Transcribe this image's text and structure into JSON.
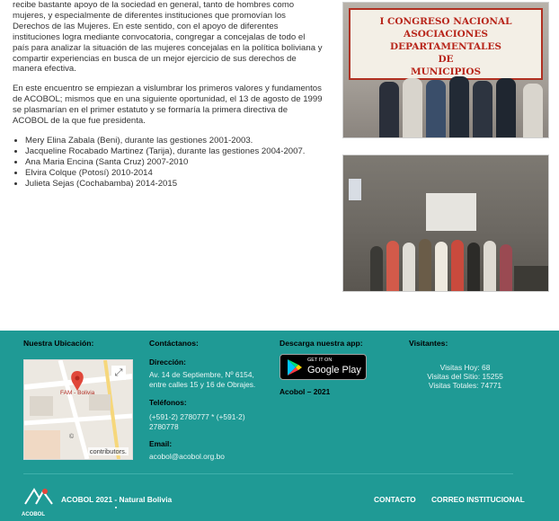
{
  "article": {
    "p1": "recibe bastante apoyo de la sociedad en general, tanto de hombres como mujeres, y especialmente de diferentes instituciones que promovían los Derechos de las Mujeres. En este sentido, con el apoyo de diferentes instituciones logra mediante convocatoria, congregar a concejalas de todo el país para analizar la situación de las mujeres concejalas en la política boliviana y compartir experiencias en busca de un mejor ejercicio de sus derechos de manera efectiva.",
    "p2": "En este encuentro se empiezan a vislumbrar los primeros valores y fundamentos de ACOBOL; mismos que en una siguiente oportunidad, el 13 de agosto de 1999 se plasmarían en el primer estatuto y se formaría la primera directiva de ACOBOL de la que fue presidenta.",
    "presidents": [
      "Mery Elina Zabala (Beni), durante las gestiones 2001-2003.",
      "Jacqueline Rocabado Martinez (Tarija), durante las gestiones 2004-2007.",
      "Ana Maria Encina (Santa Cruz) 2007-2010",
      "Elvira Colque (Potosí) 2010-2014",
      "Julieta Sejas (Cochabamba) 2014-2015"
    ]
  },
  "photo1": {
    "banner_lines": [
      "I CONGRESO NACIONAL",
      "ASOCIACIONES DEPARTAMENTALES",
      "DE",
      "MUNICIPIOS"
    ]
  },
  "footer": {
    "location_title": "Nuestra Ubicación:",
    "map_label": "FAM - Bolivia",
    "map_attribution": "contributors.",
    "map_copyright": "©",
    "contact_title": "Contáctanos:",
    "address_label": "Dirección:",
    "address": "Av. 14 de Septiembre, Nº 6154, entre calles 15 y 16 de Obrajes.",
    "phones_label": "Teléfonos:",
    "phones": "(+591-2) 2780777 * (+591-2) 2780778",
    "email_label": "Email:",
    "email": "acobol@acobol.org.bo",
    "download_title": "Descarga nuestra app:",
    "gplay_small": "GET IT ON",
    "gplay_big": "Google Play",
    "app_name": "Acobol – 2021",
    "visitors_title": "Visitantes:",
    "visits_today": "Visitas Hoy: 68",
    "visits_site": "Visitas del Sitio: 15255",
    "visits_total": "Visitas Totales: 74771",
    "copyright": "ACOBOL 2021 - Natural Bolivia",
    "logo_text": "ACOBOL",
    "nav_contact": "CONTACTO",
    "nav_mail": "CORREO INSTITUCIONAL"
  },
  "colors": {
    "footer_bg": "#1f9a95",
    "banner_red": "#b8261b"
  }
}
